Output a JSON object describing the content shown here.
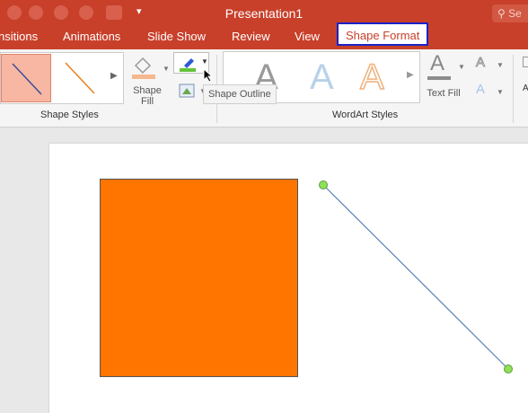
{
  "window": {
    "title": "Presentation1",
    "search_text": "Se"
  },
  "tabs": [
    {
      "label": "nsitions"
    },
    {
      "label": "Animations"
    },
    {
      "label": "Slide Show"
    },
    {
      "label": "Review"
    },
    {
      "label": "View"
    },
    {
      "label": "Shape Format",
      "active": true
    }
  ],
  "ribbon": {
    "shape_styles": {
      "group_label": "Shape Styles",
      "shape_fill_label_line1": "Shape",
      "shape_fill_label_line2": "Fill"
    },
    "tooltip": "Shape Outline",
    "wordart_styles": {
      "group_label": "WordArt Styles",
      "text_fill_label": "Text Fill",
      "glyph": "A"
    }
  },
  "colors": {
    "accent": "#c8402a",
    "active_tab_border": "#1a22c8",
    "shape_fill": "#ff7500",
    "line": "#5a82b8",
    "handle": "#8ee05a"
  }
}
